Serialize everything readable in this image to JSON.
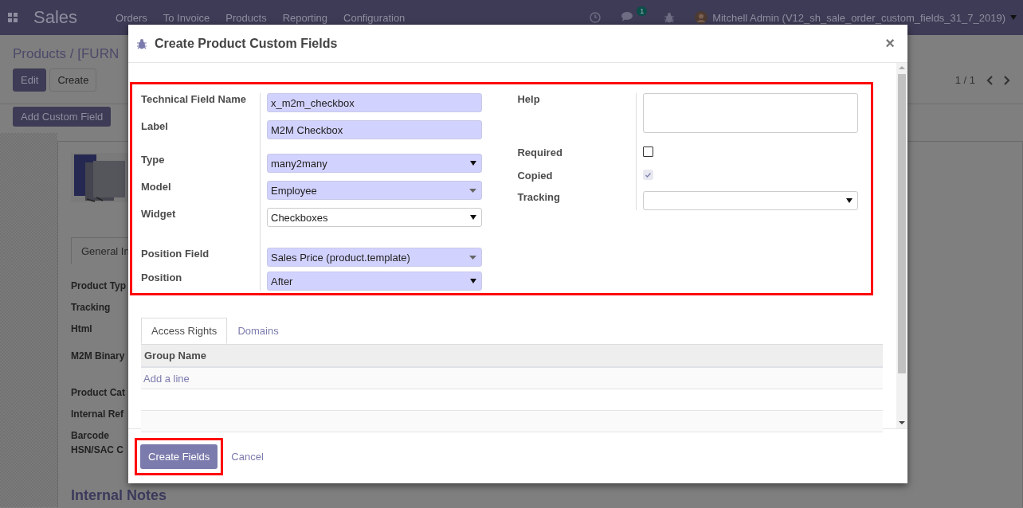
{
  "navbar": {
    "app_name": "Sales",
    "menu": [
      "Orders",
      "To Invoice",
      "Products",
      "Reporting",
      "Configuration"
    ],
    "message_count": "1",
    "user": "Mitchell Admin (V12_sh_sale_order_custom_fields_31_7_2019)"
  },
  "control_panel": {
    "breadcrumb": "Products / [FURN",
    "buttons": [
      {
        "label": "Edit",
        "kind": "primary"
      },
      {
        "label": "Create",
        "kind": "secondary"
      }
    ],
    "add_custom_field": "Add Custom Field",
    "pager": "1 / 1"
  },
  "form_sheet": {
    "tab": "General In",
    "labels": [
      "Product Typ",
      "Tracking",
      "Html",
      "M2M Binary",
      "Product Cat",
      "Internal Ref",
      "Barcode",
      "HSN/SAC C"
    ],
    "section_title": "Internal Notes"
  },
  "dialog": {
    "title": "Create Product Custom Fields",
    "close": "×",
    "left_fields": [
      {
        "label": "Technical Field Name",
        "kind": "input",
        "value": "x_m2m_checkbox",
        "required": true
      },
      {
        "label": "Label",
        "kind": "input",
        "value": "M2M Checkbox",
        "required": true
      },
      {
        "label": "Type",
        "kind": "select",
        "value": "many2many",
        "required": true
      },
      {
        "label": "Model",
        "kind": "many2one",
        "value": "Employee",
        "required": true
      },
      {
        "label": "Widget",
        "kind": "select",
        "value": "Checkboxes",
        "required": false
      },
      {
        "label": "Position Field",
        "kind": "many2one",
        "value": "Sales Price (product.template)",
        "required": true
      },
      {
        "label": "Position",
        "kind": "select",
        "value": "After",
        "required": true
      }
    ],
    "right_fields": [
      {
        "label": "Help",
        "kind": "textarea",
        "required": false
      },
      {
        "label": "Required",
        "kind": "checkbox",
        "checked": false,
        "disabled": false
      },
      {
        "label": "Copied",
        "kind": "checkbox",
        "checked": true,
        "disabled": true
      },
      {
        "label": "Tracking",
        "kind": "select",
        "required": false
      }
    ],
    "tabs": [
      {
        "label": "Access Rights",
        "selected": true
      },
      {
        "label": "Domains",
        "selected": false
      }
    ],
    "table": {
      "columns": [
        "Group Name"
      ],
      "add_line": "Add a line"
    },
    "buttons": {
      "primary": "Create Fields",
      "secondary": "Cancel"
    }
  }
}
